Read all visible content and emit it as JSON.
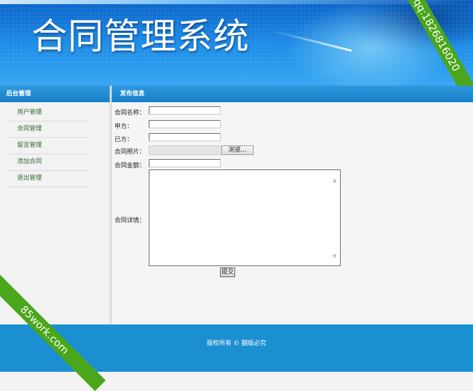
{
  "banner": {
    "title": "合同管理系统",
    "contact": "qq:1826816020"
  },
  "watermark": "85work.com",
  "sidebar": {
    "title": "后台管理",
    "items": [
      {
        "label": "用户管理"
      },
      {
        "label": "合同管理"
      },
      {
        "label": "留言管理"
      },
      {
        "label": "添加合同"
      },
      {
        "label": "退出管理"
      }
    ]
  },
  "main": {
    "title": "发布信息",
    "form": {
      "contract_name_label": "合同名称：",
      "contract_name_value": "",
      "party_a_label": "甲方：",
      "party_a_value": "",
      "party_b_label": "已方：",
      "party_b_value": "",
      "photo_label": "合同照片：",
      "browse_label": "浏览...",
      "amount_label": "合同金额：",
      "amount_value": "",
      "details_label": "合同详情：",
      "details_value": "",
      "submit_label": "提交"
    }
  },
  "footer": {
    "copyright": "版权所有 © 翻版必究"
  },
  "colors": {
    "header_blue": "#1880c9",
    "footer_blue": "#1b8fd2",
    "ribbon_green": "#4aa61a",
    "menu_text": "#2e6b2e"
  }
}
